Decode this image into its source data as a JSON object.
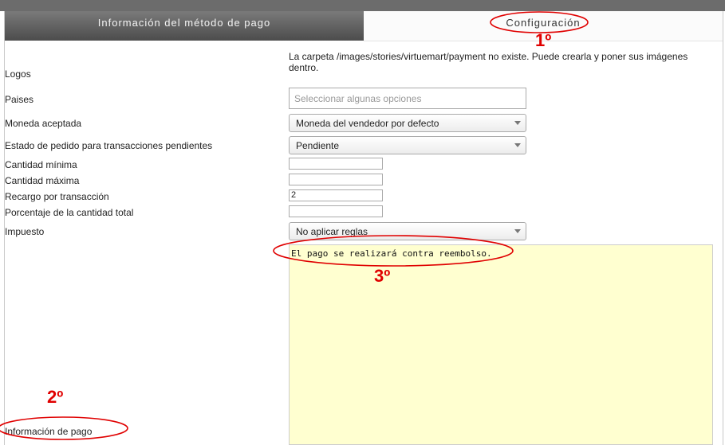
{
  "tabs": {
    "payment_info": "Información del método de pago",
    "configuration": "Configuración"
  },
  "form": {
    "logos_label": "Logos",
    "logos_note": "La carpeta /images/stories/virtuemart/payment no existe. Puede crearla y poner sus imágenes dentro.",
    "countries_label": "Paises",
    "countries_placeholder": "Seleccionar algunas opciones",
    "currency_label": "Moneda aceptada",
    "currency_value": "Moneda del vendedor por defecto",
    "pending_status_label": "Estado de pedido para transacciones pendientes",
    "pending_status_value": "Pendiente",
    "min_amount_label": "Cantidad mínima",
    "min_amount_value": "",
    "max_amount_label": "Cantidad máxima",
    "max_amount_value": "",
    "fee_label": "Recargo por transacción",
    "fee_value": "2",
    "percent_label": "Porcentaje de la cantidad total",
    "percent_value": "",
    "tax_label": "Impuesto",
    "tax_value": "No aplicar reglas",
    "payment_info_label": "Información de pago",
    "payment_info_text": "El pago se realizará contra reembolso."
  },
  "annotations": {
    "step1": "1º",
    "step2": "2º",
    "step3": "3º",
    "color": "#e00000"
  }
}
